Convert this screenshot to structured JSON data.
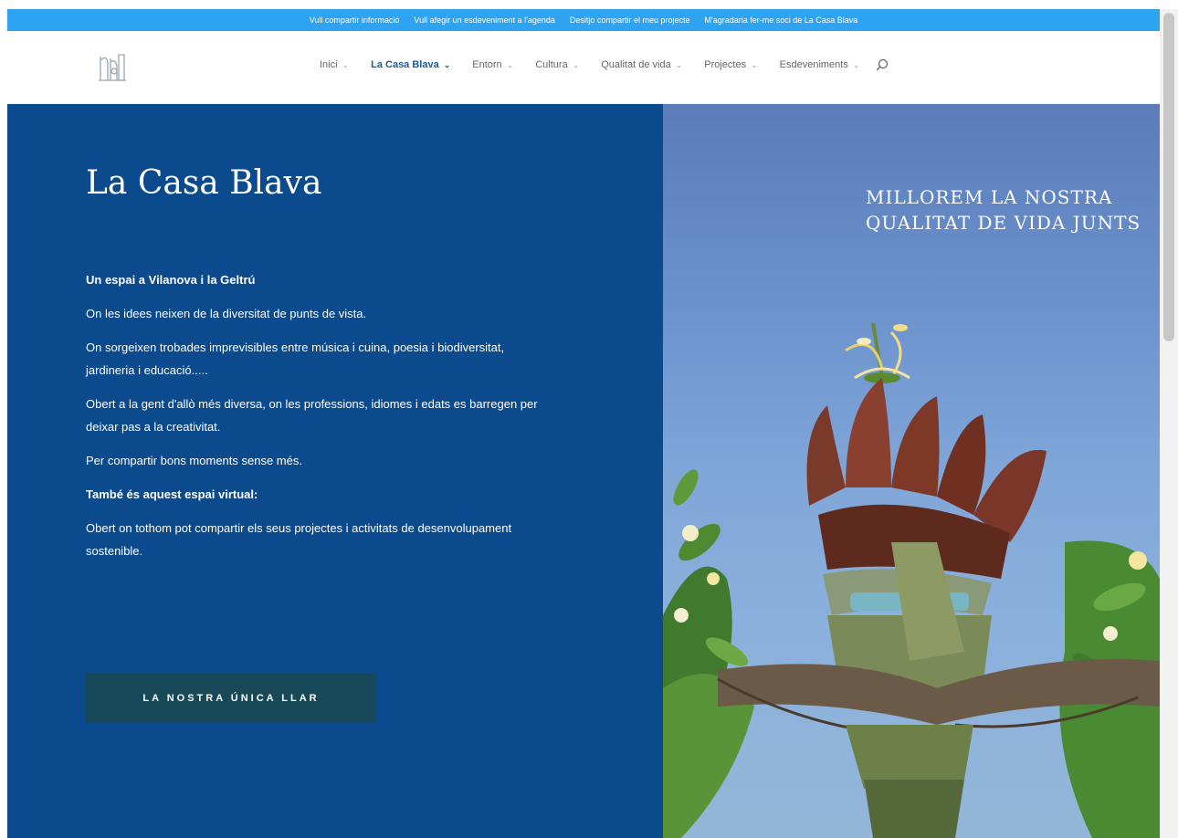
{
  "topbar": {
    "links": [
      "Vull compartir informació",
      "Vull afegir un esdeveniment a l'agenda",
      "Desitjo compartir el meu projecte",
      "M'agradaria fer-me soci de La Casa Blava"
    ]
  },
  "nav": {
    "items": [
      {
        "label": "Inici"
      },
      {
        "label": "La Casa Blava"
      },
      {
        "label": "Entorn"
      },
      {
        "label": "Cultura"
      },
      {
        "label": "Qualitat de vida"
      },
      {
        "label": "Projectes"
      },
      {
        "label": "Esdeveniments"
      }
    ],
    "active_index": 1
  },
  "main": {
    "title": "La Casa Blava",
    "subtitle": "Un espai a Vilanova i la Geltrú",
    "paragraphs": [
      "On les idees neixen de la diversitat de punts de vista.",
      "On sorgeixen trobades imprevisibles entre música i cuina, poesia i biodiversitat, jardineria i educació.....",
      "Obert a la gent d'allò més diversa, on les professions, idiomes i edats es barregen per deixar pas a la creativitat.",
      "Per compartir bons moments sense més."
    ],
    "subtitle2": "També és aquest espai virtual:",
    "paragraph_last": " Obert on tothom pot compartir els seus projectes i activitats de desenvolupament sostenible.",
    "cta_label": "LA NOSTRA ÚNICA LLAR"
  },
  "hero": {
    "tagline": "MILLOREM LA NOSTRA QUALITAT DE VIDA JUNTS"
  },
  "colors": {
    "topbar": "#2ea3f2",
    "panel": "#0b4a8c",
    "cta": "#174959",
    "nav_active": "#1a5a94"
  }
}
